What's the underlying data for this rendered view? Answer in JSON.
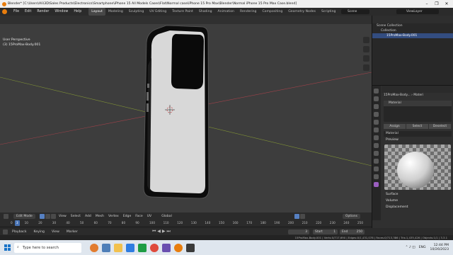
{
  "window": {
    "title": "Blender* [C:\\Users\\Ali\\3D\\Sales Products\\Electronics\\Smartphone\\iPhone 15 All Models Cases\\Flat\\Normal case\\iPhone 15 Pro Max\\Blender\\Normal iPhone 15 Pro Max Case.blend]",
    "controls": [
      "–",
      "❐",
      "✕"
    ]
  },
  "topbar": {
    "menus": [
      "File",
      "Edit",
      "Render",
      "Window",
      "Help"
    ],
    "workspaces": [
      "Layout",
      "Modeling",
      "Sculpting",
      "UV Editing",
      "Texture Paint",
      "Shading",
      "Animation",
      "Rendering",
      "Compositing",
      "Geometry Nodes",
      "Scripting",
      "+"
    ],
    "active_workspace": "Layout",
    "scene": "Scene",
    "view_layer": "ViewLayer"
  },
  "viewport": {
    "info_line1": "User Perspective",
    "info_line2": "(3) 15ProMax-Body.001",
    "editor_menus": [
      "View",
      "Select",
      "Add",
      "Mesh",
      "Vertex",
      "Edge",
      "Face",
      "UV"
    ],
    "mode": "Edit Mode",
    "transform": "Global",
    "options": "Options"
  },
  "outliner": {
    "rows": [
      "Scene Collection",
      "Collection",
      "15ProMax-Body.001"
    ]
  },
  "properties": {
    "breadcrumb_object": "15ProMax-Body...",
    "breadcrumb_material": "Materi",
    "slot_name": "Material",
    "assign": "Assign",
    "select": "Select",
    "deselect": "Deselect",
    "material_name": "Material",
    "panels": [
      "Preview",
      "Surface",
      "Volume",
      "Displacement"
    ]
  },
  "timeline": {
    "menus": [
      "Playback",
      "Keying",
      "View",
      "Marker"
    ],
    "current_frame": "3",
    "start_label": "Start",
    "start": "1",
    "end_label": "End",
    "end": "250",
    "ticks": [
      "0",
      "10",
      "20",
      "30",
      "40",
      "50",
      "60",
      "70",
      "80",
      "90",
      "100",
      "110",
      "120",
      "130",
      "140",
      "150",
      "160",
      "170",
      "180",
      "190",
      "200",
      "210",
      "220",
      "230",
      "240",
      "250"
    ]
  },
  "statusbar": {
    "text": "15ProMax-Body.001 | Verts:0/717,690 | Edges:0/1,431,078 | Faces:0/713,386 | Tris:1,435,426 | Objects:1/1 | 3.3.1"
  },
  "taskbar": {
    "search_placeholder": "Type here to search",
    "lang": "ENG",
    "time": "12:44 PM",
    "date": "10/26/2023"
  },
  "colors": {
    "accent": "#e87d0d",
    "selection": "#334d80",
    "material_tab": "#9b5fc0"
  }
}
